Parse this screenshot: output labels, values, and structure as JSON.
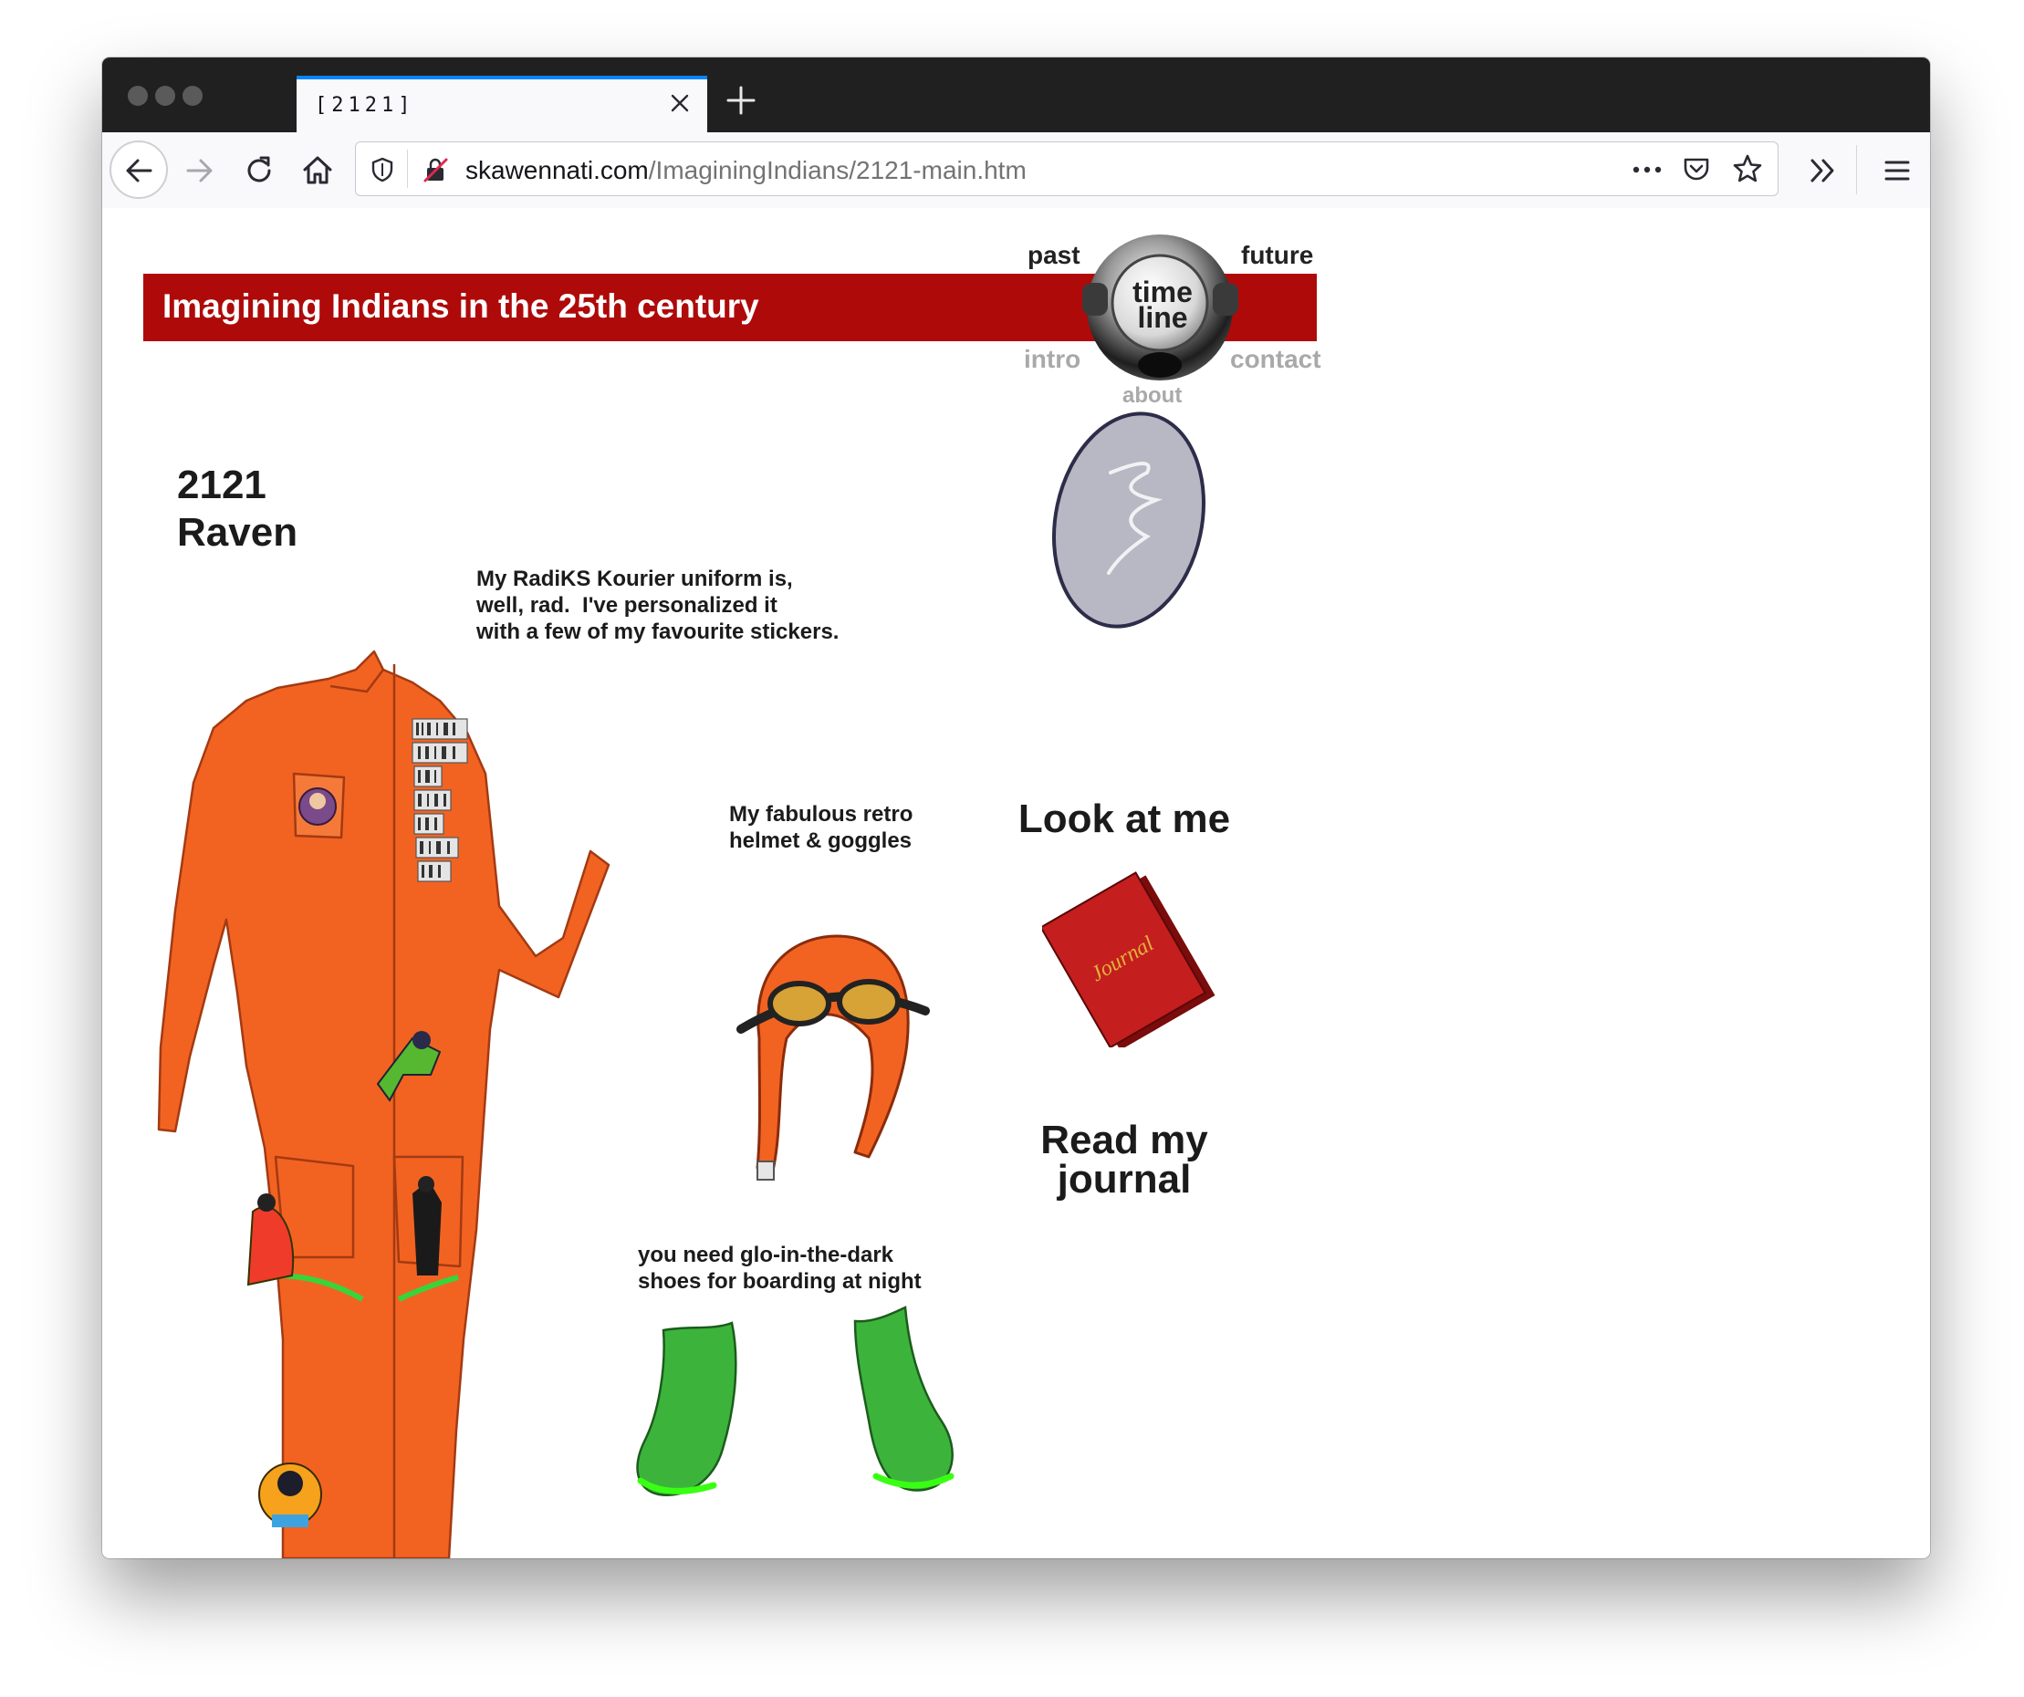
{
  "browser": {
    "tab_title": "[2121]",
    "url_domain": "skawennati.com",
    "url_path": "/ImaginingIndians/2121-main.htm",
    "accent_color": "#0a84ff"
  },
  "page": {
    "banner_title": "Imagining Indians in the 25th century",
    "banner_color": "#ae0a0a",
    "nav": {
      "past": "past",
      "future": "future",
      "timeline_line1": "time",
      "timeline_line2": "line",
      "intro": "intro",
      "contact": "contact",
      "about": "about"
    },
    "year": "2121",
    "character": "Raven",
    "captions": {
      "uniform": "My RadiKS Kourier uniform is,\nwell, rad.  I've personalized it\nwith a few of my favourite stickers.",
      "helmet": "My fabulous retro\nhelmet & goggles",
      "shoes": "you need glo-in-the-dark\nshoes for boarding at night"
    },
    "links": {
      "look": "Look at me",
      "journal_line1": "Read my",
      "journal_line2": "journal"
    },
    "journal_cover_text": "Journal",
    "colors": {
      "uniform": "#f26322",
      "shoes": "#3cb43c",
      "shoe_glow": "#39ff14",
      "mirror": "#b8b8c4",
      "journal": "#c41e1e"
    }
  }
}
